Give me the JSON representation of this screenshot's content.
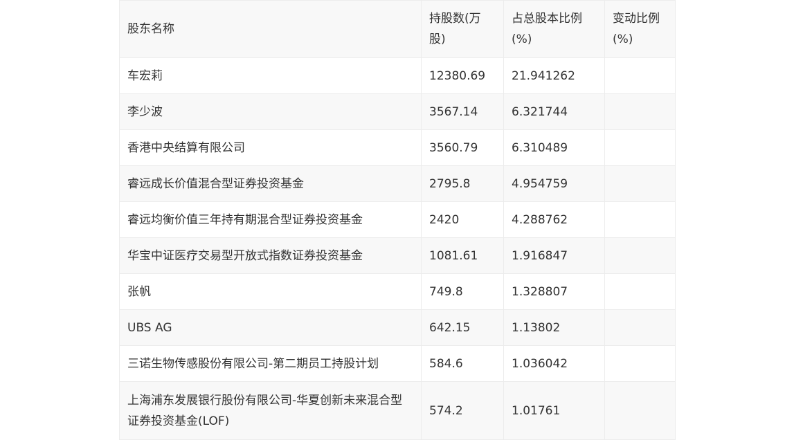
{
  "table": {
    "headers": [
      "股东名称",
      "持股数(万股)",
      "占总股本比例(%)",
      "变动比例(%)"
    ],
    "rows": [
      [
        "车宏莉",
        "12380.69",
        "21.941262",
        ""
      ],
      [
        "李少波",
        "3567.14",
        "6.321744",
        ""
      ],
      [
        "香港中央结算有限公司",
        "3560.79",
        "6.310489",
        ""
      ],
      [
        "睿远成长价值混合型证券投资基金",
        "2795.8",
        "4.954759",
        ""
      ],
      [
        "睿远均衡价值三年持有期混合型证券投资基金",
        "2420",
        "4.288762",
        ""
      ],
      [
        "华宝中证医疗交易型开放式指数证券投资基金",
        "1081.61",
        "1.916847",
        ""
      ],
      [
        "张帆",
        "749.8",
        "1.328807",
        ""
      ],
      [
        "UBS AG",
        "642.15",
        "1.13802",
        ""
      ],
      [
        "三诺生物传感股份有限公司-第二期员工持股计划",
        "584.6",
        "1.036042",
        ""
      ],
      [
        "上海浦东发展银行股份有限公司-华夏创新未来混合型证券投资基金(LOF)",
        "574.2",
        "1.01761",
        ""
      ]
    ]
  }
}
